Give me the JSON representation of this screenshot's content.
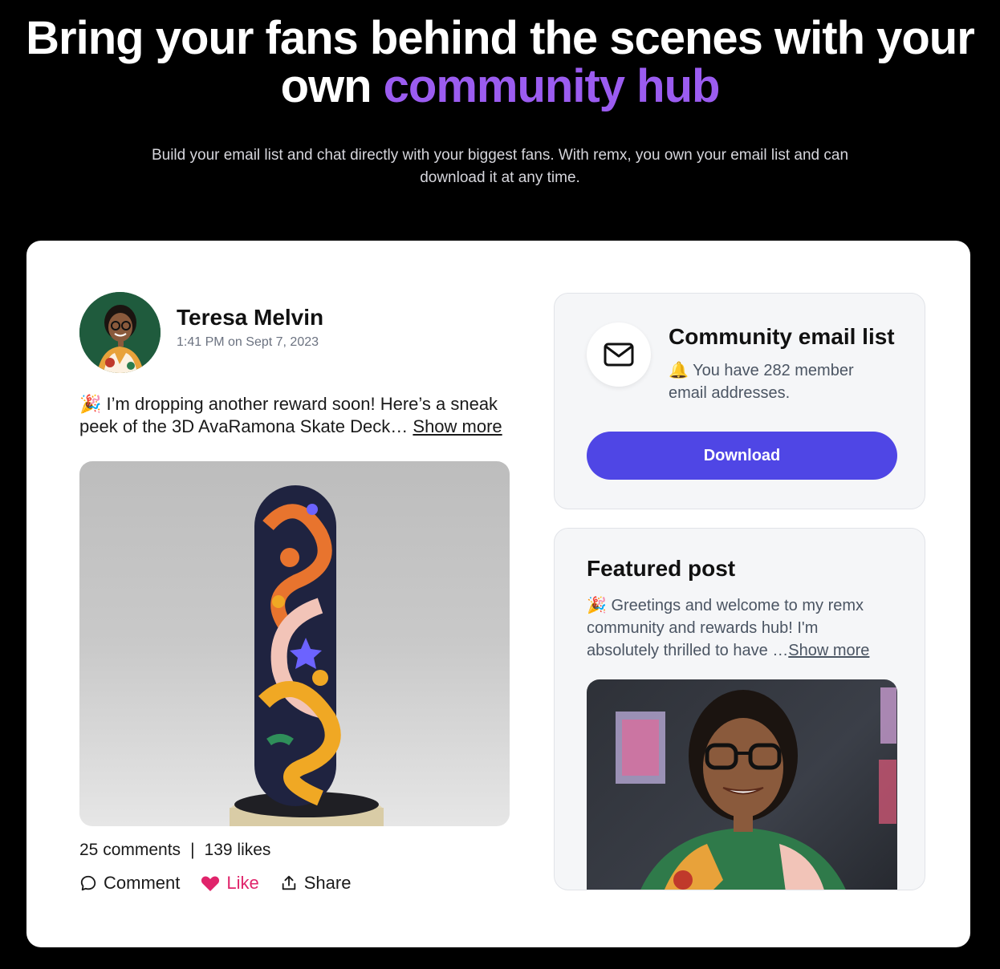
{
  "hero": {
    "title_line1": "Bring your fans behind the scenes with your",
    "title_line2_plain": "own ",
    "title_line2_accent": "community hub",
    "subtitle": "Build your email list and chat directly with your biggest fans. With remx, you own your email list and can download it at any time."
  },
  "post": {
    "author": "Teresa Melvin",
    "timestamp": "1:41 PM on Sept 7, 2023",
    "emoji": "🎉",
    "text": " I’m dropping another reward soon! Here’s a sneak peek of the 3D AvaRamona Skate Deck… ",
    "show_more": "Show more",
    "comments": "25 comments",
    "separator": "|",
    "likes": "139 likes",
    "actions": {
      "comment": "Comment",
      "like": "Like",
      "share": "Share"
    }
  },
  "email_panel": {
    "title": "Community email list",
    "bell": "🔔",
    "description": " You have 282 member email addresses.",
    "button": "Download"
  },
  "featured_panel": {
    "title": "Featured post",
    "emoji": "🎉",
    "text": " Greetings and welcome to my remx community and rewards hub! I'm absolutely thrilled to have …",
    "show_more": "Show more"
  },
  "colors": {
    "accent_purple": "#9b5cf0",
    "button_indigo": "#4f46e5",
    "like_pink": "#e0246b"
  }
}
